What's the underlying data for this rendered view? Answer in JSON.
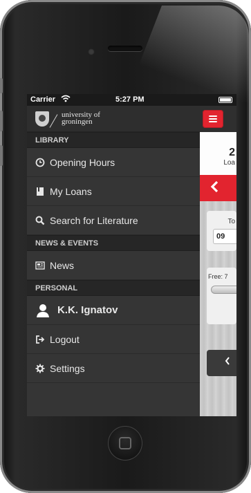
{
  "status_bar": {
    "carrier": "Carrier",
    "wifi_icon": "wifi-icon",
    "time": "5:27 PM",
    "battery_icon": "battery-icon"
  },
  "header": {
    "logo_icon": "university-crest-icon",
    "logo_line1": "university of",
    "logo_line2": "groningen"
  },
  "sections": {
    "library": "LIBRARY",
    "news_events": "NEWS & EVENTS",
    "personal": "PERSONAL"
  },
  "menu_items": {
    "opening_hours": {
      "label": "Opening Hours",
      "icon": "clock-icon"
    },
    "my_loans": {
      "label": "My Loans",
      "icon": "book-icon"
    },
    "search": {
      "label": "Search for Literature",
      "icon": "search-icon"
    },
    "news": {
      "label": "News",
      "icon": "newspaper-icon"
    },
    "user": {
      "label": "K.K. Ignatov",
      "icon": "user-icon"
    },
    "logout": {
      "label": "Logout",
      "icon": "logout-icon"
    },
    "settings": {
      "label": "Settings",
      "icon": "gear-icon"
    }
  },
  "right_panel": {
    "menu_button_icon": "hamburger-icon",
    "count": "2",
    "count_label": "Loa",
    "back_icon": "chevron-left-icon",
    "card1_title": "To",
    "card1_value": "09",
    "card2_title": "Free: 7",
    "card3_icon": "chevron-left-icon"
  },
  "colors": {
    "accent_red": "#e2242f",
    "menu_bg": "#353535",
    "section_bg": "#262626"
  }
}
